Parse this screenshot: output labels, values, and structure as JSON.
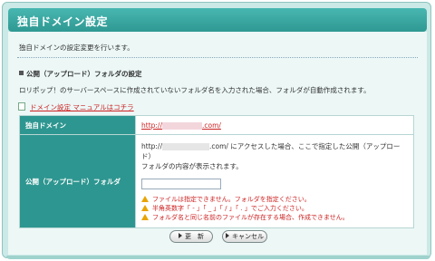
{
  "header": {
    "title": "独自ドメイン設定"
  },
  "intro": "独自ドメインの設定変更を行います。",
  "section": {
    "title": "公開（アップロード）フォルダの設定",
    "description": "ロリポップ！のサーバースペースに作成されていないフォルダ名を入力された場合、フォルダが自動作成されます。",
    "manual_link": "ドメイン設定 マニュアルはコチラ"
  },
  "form": {
    "domain_label": "独自ドメイン",
    "domain_prefix": "http://",
    "domain_suffix": ".com/",
    "folder_label": "公開（アップロード）フォルダ",
    "folder_desc_prefix": "http://",
    "folder_desc_suffix": ".com/ にアクセスした場合、ここで指定した公開（アップロード）",
    "folder_desc_line2": "フォルダの内容が表示されます。",
    "folder_input_value": "",
    "warnings": [
      "ファイルは指定できません。フォルダを指定ください。",
      "半角英数字「 - 」「 _ 」「 / 」「 . 」でご入力ください。",
      "フォルダ名と同じ名前のファイルが存在する場合、作成できません。"
    ]
  },
  "buttons": {
    "update": "更　新",
    "cancel": "キャンセル"
  },
  "colors": {
    "accent": "#2e9690",
    "warning": "#cc2222",
    "background": "#cbe9e6"
  }
}
